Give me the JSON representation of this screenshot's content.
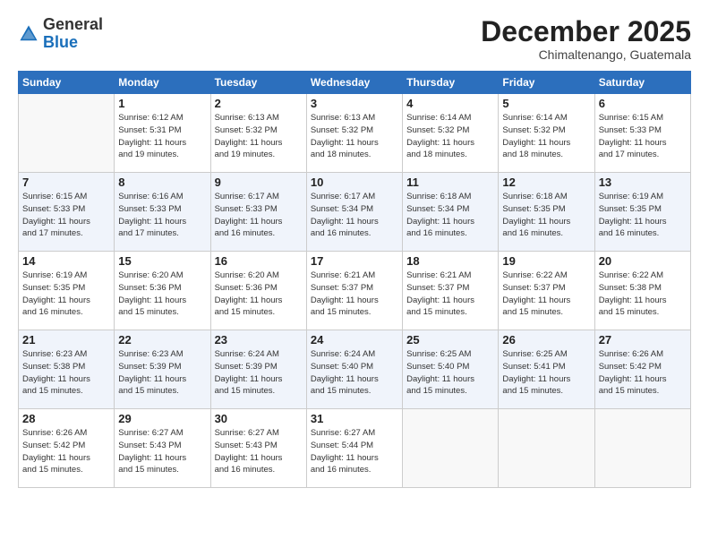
{
  "header": {
    "logo_general": "General",
    "logo_blue": "Blue",
    "month_title": "December 2025",
    "location": "Chimaltenango, Guatemala"
  },
  "weekdays": [
    "Sunday",
    "Monday",
    "Tuesday",
    "Wednesday",
    "Thursday",
    "Friday",
    "Saturday"
  ],
  "weeks": [
    [
      {
        "day": "",
        "info": ""
      },
      {
        "day": "1",
        "info": "Sunrise: 6:12 AM\nSunset: 5:31 PM\nDaylight: 11 hours\nand 19 minutes."
      },
      {
        "day": "2",
        "info": "Sunrise: 6:13 AM\nSunset: 5:32 PM\nDaylight: 11 hours\nand 19 minutes."
      },
      {
        "day": "3",
        "info": "Sunrise: 6:13 AM\nSunset: 5:32 PM\nDaylight: 11 hours\nand 18 minutes."
      },
      {
        "day": "4",
        "info": "Sunrise: 6:14 AM\nSunset: 5:32 PM\nDaylight: 11 hours\nand 18 minutes."
      },
      {
        "day": "5",
        "info": "Sunrise: 6:14 AM\nSunset: 5:32 PM\nDaylight: 11 hours\nand 18 minutes."
      },
      {
        "day": "6",
        "info": "Sunrise: 6:15 AM\nSunset: 5:33 PM\nDaylight: 11 hours\nand 17 minutes."
      }
    ],
    [
      {
        "day": "7",
        "info": "Sunrise: 6:15 AM\nSunset: 5:33 PM\nDaylight: 11 hours\nand 17 minutes."
      },
      {
        "day": "8",
        "info": "Sunrise: 6:16 AM\nSunset: 5:33 PM\nDaylight: 11 hours\nand 17 minutes."
      },
      {
        "day": "9",
        "info": "Sunrise: 6:17 AM\nSunset: 5:33 PM\nDaylight: 11 hours\nand 16 minutes."
      },
      {
        "day": "10",
        "info": "Sunrise: 6:17 AM\nSunset: 5:34 PM\nDaylight: 11 hours\nand 16 minutes."
      },
      {
        "day": "11",
        "info": "Sunrise: 6:18 AM\nSunset: 5:34 PM\nDaylight: 11 hours\nand 16 minutes."
      },
      {
        "day": "12",
        "info": "Sunrise: 6:18 AM\nSunset: 5:35 PM\nDaylight: 11 hours\nand 16 minutes."
      },
      {
        "day": "13",
        "info": "Sunrise: 6:19 AM\nSunset: 5:35 PM\nDaylight: 11 hours\nand 16 minutes."
      }
    ],
    [
      {
        "day": "14",
        "info": "Sunrise: 6:19 AM\nSunset: 5:35 PM\nDaylight: 11 hours\nand 16 minutes."
      },
      {
        "day": "15",
        "info": "Sunrise: 6:20 AM\nSunset: 5:36 PM\nDaylight: 11 hours\nand 15 minutes."
      },
      {
        "day": "16",
        "info": "Sunrise: 6:20 AM\nSunset: 5:36 PM\nDaylight: 11 hours\nand 15 minutes."
      },
      {
        "day": "17",
        "info": "Sunrise: 6:21 AM\nSunset: 5:37 PM\nDaylight: 11 hours\nand 15 minutes."
      },
      {
        "day": "18",
        "info": "Sunrise: 6:21 AM\nSunset: 5:37 PM\nDaylight: 11 hours\nand 15 minutes."
      },
      {
        "day": "19",
        "info": "Sunrise: 6:22 AM\nSunset: 5:37 PM\nDaylight: 11 hours\nand 15 minutes."
      },
      {
        "day": "20",
        "info": "Sunrise: 6:22 AM\nSunset: 5:38 PM\nDaylight: 11 hours\nand 15 minutes."
      }
    ],
    [
      {
        "day": "21",
        "info": "Sunrise: 6:23 AM\nSunset: 5:38 PM\nDaylight: 11 hours\nand 15 minutes."
      },
      {
        "day": "22",
        "info": "Sunrise: 6:23 AM\nSunset: 5:39 PM\nDaylight: 11 hours\nand 15 minutes."
      },
      {
        "day": "23",
        "info": "Sunrise: 6:24 AM\nSunset: 5:39 PM\nDaylight: 11 hours\nand 15 minutes."
      },
      {
        "day": "24",
        "info": "Sunrise: 6:24 AM\nSunset: 5:40 PM\nDaylight: 11 hours\nand 15 minutes."
      },
      {
        "day": "25",
        "info": "Sunrise: 6:25 AM\nSunset: 5:40 PM\nDaylight: 11 hours\nand 15 minutes."
      },
      {
        "day": "26",
        "info": "Sunrise: 6:25 AM\nSunset: 5:41 PM\nDaylight: 11 hours\nand 15 minutes."
      },
      {
        "day": "27",
        "info": "Sunrise: 6:26 AM\nSunset: 5:42 PM\nDaylight: 11 hours\nand 15 minutes."
      }
    ],
    [
      {
        "day": "28",
        "info": "Sunrise: 6:26 AM\nSunset: 5:42 PM\nDaylight: 11 hours\nand 15 minutes."
      },
      {
        "day": "29",
        "info": "Sunrise: 6:27 AM\nSunset: 5:43 PM\nDaylight: 11 hours\nand 15 minutes."
      },
      {
        "day": "30",
        "info": "Sunrise: 6:27 AM\nSunset: 5:43 PM\nDaylight: 11 hours\nand 16 minutes."
      },
      {
        "day": "31",
        "info": "Sunrise: 6:27 AM\nSunset: 5:44 PM\nDaylight: 11 hours\nand 16 minutes."
      },
      {
        "day": "",
        "info": ""
      },
      {
        "day": "",
        "info": ""
      },
      {
        "day": "",
        "info": ""
      }
    ]
  ]
}
